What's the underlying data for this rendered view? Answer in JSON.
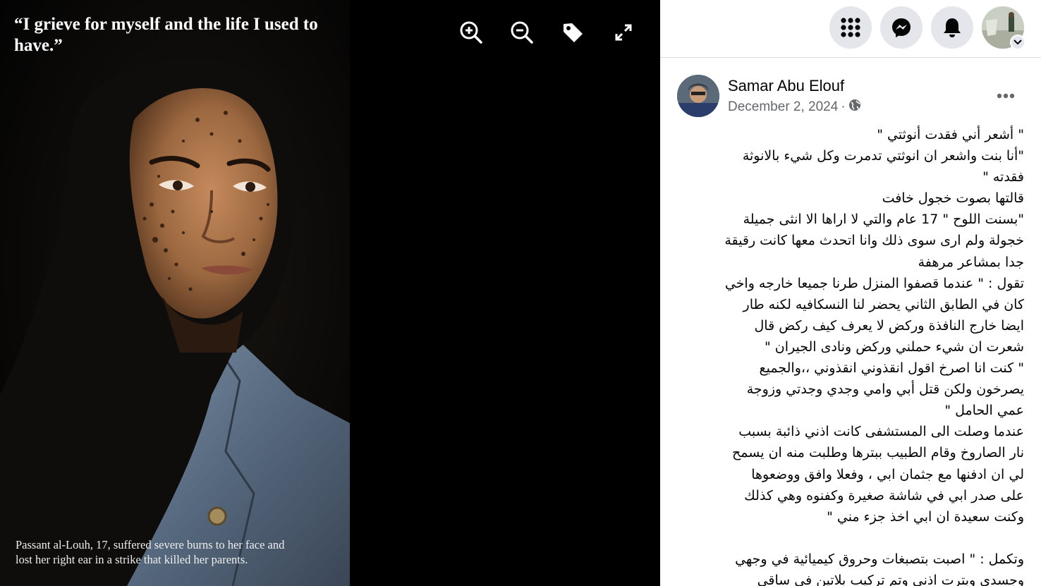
{
  "viewer": {
    "quote": "“I grieve for myself and the life I used to have.”",
    "caption": "Passant al-Louh, 17, suffered severe burns to her face and lost her right ear in a strike that killed her parents.",
    "tools": [
      "zoom-in-icon",
      "zoom-out-icon",
      "tag-icon",
      "fullscreen-icon"
    ]
  },
  "topbar": {
    "icons": [
      "menu-grid-icon",
      "messenger-icon",
      "notifications-bell-icon",
      "account-avatar"
    ]
  },
  "post": {
    "author": "Samar Abu Elouf",
    "date": "December 2, 2024",
    "separator": "·",
    "privacy_icon": "globe-icon",
    "lines": [
      "\" أشعر أني فقدت أنوثتي \"",
      "\"أنا بنت واشعر ان انوثتي تدمرت وكل شيء بالانوثة",
      "فقدته \"",
      "قالتها بصوت خجول خافت",
      "\"بسنت اللوح \" 17 عام والتي لا اراها الا انثى جميلة",
      "خجولة ولم ارى سوى ذلك وانا اتحدث معها كانت رقيقة",
      "جدا بمشاعر مرهفة",
      "تقول : \" عندما قصفوا المنزل طرنا جميعا خارجه واخي",
      "كان في الطابق الثاني يحضر لنا النسكافيه لكنه طار",
      "ايضا خارج النافذة وركض لا يعرف كيف ركض قال",
      "شعرت ان شيء حملني وركض ونادى الجيران \"",
      "\" كنت انا اصرخ اقول انقذوني انقذوني ،،والجميع",
      "يصرخون ولكن قتل أبي وامي وجدي وجدتي وزوجة",
      "عمي الحامل \"",
      "عندما وصلت الى المستشفى كانت اذني ذائبة بسبب",
      "نار الصاروخ وقام الطبيب ببترها وطلبت منه ان يسمح",
      "لي ان ادفنها مع جثمان ابي ، وفعلا وافق ووضعوها",
      "على صدر ابي في شاشة صغيرة وكفنوه وهي كذلك",
      "وكنت سعيدة ان ابي اخذ جزء مني \"",
      "",
      "وتكمل : \" اصبت بتصبغات وحروق كيميائية في وجهي",
      "وجسدي وبترت اذني وتم تركيب بلاتين في ساقي"
    ]
  },
  "colors": {
    "panel_bg": "#ffffff",
    "icon_circle_bg": "#e4e6eb",
    "secondary_text": "#65676b",
    "viewer_bg": "#000000"
  }
}
